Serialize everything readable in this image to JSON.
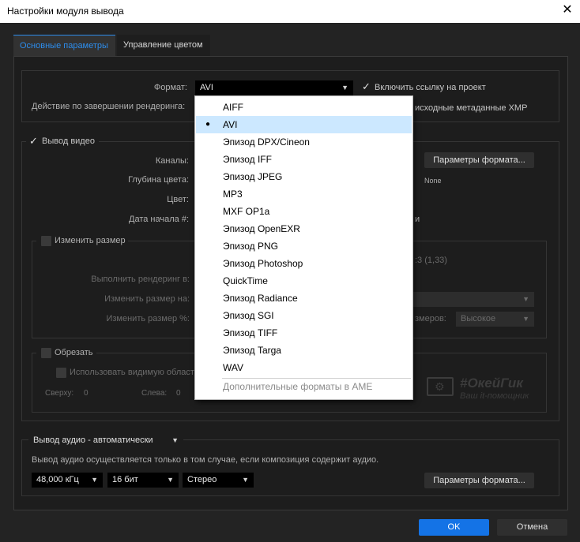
{
  "window": {
    "title": "Настройки модуля вывода",
    "close_glyph": "✕"
  },
  "tabs": [
    {
      "label": "Основные параметры",
      "active": true
    },
    {
      "label": "Управление цветом",
      "active": false
    }
  ],
  "format": {
    "label": "Формат:",
    "value": "AVI",
    "include_link_label": "Включить ссылку на проект",
    "post_render_label": "Действие по завершении рендеринга:",
    "xmp_label": "исходные метаданные XMP"
  },
  "video": {
    "section_label": "Вывод видео",
    "channels_label": "Каналы:",
    "depth_label": "Глубина цвета:",
    "color_label": "Цвет:",
    "start_label": "Дата начала #:",
    "format_options_button": "Параметры формата...",
    "codec_value": "None",
    "partial_m": "и"
  },
  "resize": {
    "section_label": "Изменить размер",
    "render_at_label": "Выполнить рендеринг в:",
    "resize_to_label": "Изменить размер на:",
    "resize_pct_label": "Изменить размер %:",
    "aspect_partial": ":3 (1,33)",
    "quality_label_partial": "змеров:",
    "quality_value": "Высокое"
  },
  "crop": {
    "section_label": "Обрезать",
    "use_roi_label": "Использовать видимую област",
    "top_label": "Сверху:",
    "top_value": "0",
    "left_label": "Слева:",
    "left_value": "0"
  },
  "audio": {
    "mode_value": "Вывод аудио - автоматически",
    "note": "Вывод аудио осуществляется только в том случае, если композиция содержит аудио.",
    "rate_value": "48,000 кГц",
    "bits_value": "16 бит",
    "channels_value": "Стерео",
    "format_options_button": "Параметры формата..."
  },
  "buttons": {
    "ok": "OK",
    "cancel": "Отмена"
  },
  "dropdown": {
    "items": [
      "AIFF",
      "AVI",
      "Эпизод DPX/Cineon",
      "Эпизод IFF",
      "Эпизод JPEG",
      "MP3",
      "MXF OP1a",
      "Эпизод OpenEXR",
      "Эпизод PNG",
      "Эпизод Photoshop",
      "QuickTime",
      "Эпизод Radiance",
      "Эпизод SGI",
      "Эпизод TIFF",
      "Эпизод Targa",
      "WAV"
    ],
    "selected": "AVI",
    "more_label": "Дополнительные форматы в AME"
  },
  "watermark": {
    "brand": "#ОкейГик",
    "tagline": "Ваш it-помощник"
  },
  "colors": {
    "accent": "#1473e6",
    "tab_accent": "#2d8ceb",
    "dialog_bg": "#232323",
    "panel_bg": "#1d1d1d"
  }
}
